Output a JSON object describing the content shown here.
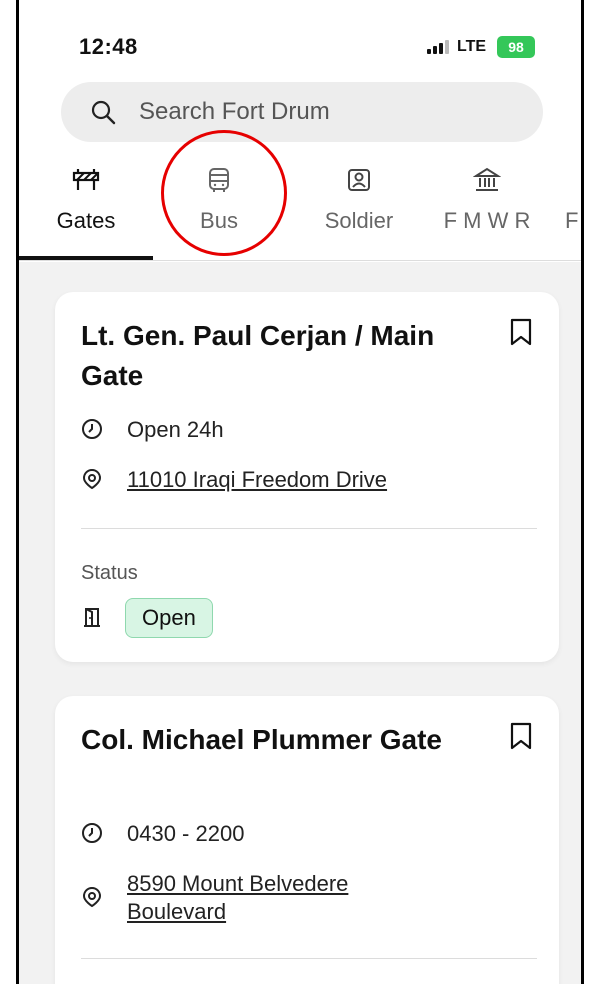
{
  "status_bar": {
    "time": "12:48",
    "network": "LTE",
    "battery": "98"
  },
  "search": {
    "placeholder": "Search Fort Drum"
  },
  "tabs": [
    {
      "label": "Gates",
      "icon": "gate-barrier-icon",
      "active": true
    },
    {
      "label": "Bus",
      "icon": "bus-icon",
      "active": false
    },
    {
      "label": "Soldier",
      "icon": "soldier-badge-icon",
      "active": false
    },
    {
      "label": "F M W R",
      "icon": "bank-building-icon",
      "active": false
    },
    {
      "label": "F",
      "icon": "",
      "active": false
    }
  ],
  "cards": [
    {
      "title": "Lt. Gen. Paul Cerjan / Main Gate",
      "hours": "Open 24h",
      "address": "11010 Iraqi Freedom Drive",
      "status_label": "Status",
      "status": "Open"
    },
    {
      "title": "Col. Michael Plummer Gate",
      "hours": "0430 - 2200",
      "address": "8590 Mount Belvedere Boulevard"
    }
  ],
  "colors": {
    "battery": "#34c759",
    "open_badge_bg": "#d8f5e4",
    "annotation_circle": "#e60000",
    "top_arc": "#2d6b1f"
  }
}
